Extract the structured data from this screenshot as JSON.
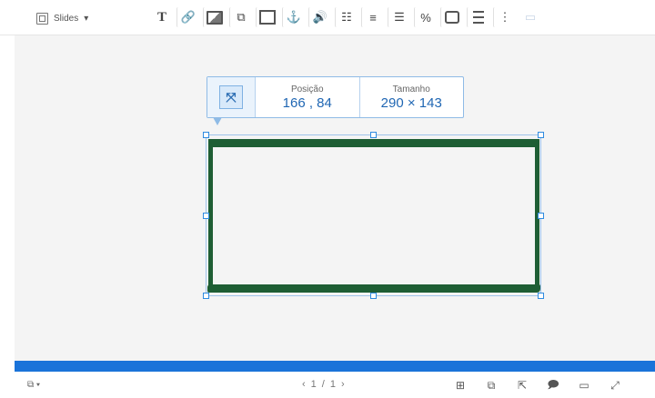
{
  "toolbar": {
    "slides_menu_label": "Slides",
    "slides_menu_caret": "▾",
    "tools": [
      {
        "name": "text-tool-icon",
        "glyph": "T"
      },
      {
        "name": "link-tool-icon",
        "glyph": "%"
      },
      {
        "name": "image-tool-icon",
        "glyph": ""
      },
      {
        "name": "shape-tool-icon",
        "glyph": "⧉"
      },
      {
        "name": "video-tool-icon",
        "glyph": ""
      },
      {
        "name": "anchor-tool-icon",
        "glyph": "⚓"
      },
      {
        "name": "audio-tool-icon",
        "glyph": "🔊"
      },
      {
        "name": "options-tool-icon",
        "glyph": "☷"
      },
      {
        "name": "numbered-list-icon",
        "glyph": "≡"
      },
      {
        "name": "bullet-list-icon",
        "glyph": "☰"
      },
      {
        "name": "percent-tool-icon",
        "glyph": "%"
      },
      {
        "name": "comment-tool-icon",
        "glyph": "🗨"
      },
      {
        "name": "align-tool-icon",
        "glyph": "≣"
      },
      {
        "name": "more-menu-icon",
        "glyph": "⋮"
      },
      {
        "name": "panel-toggle-icon",
        "glyph": "▭"
      }
    ]
  },
  "tooltip": {
    "fit_icon": "⤧",
    "position_label": "Posição",
    "position_value": "166 , 84",
    "size_label": "Tamanho",
    "size_value": "290 × 143"
  },
  "bottombar": {
    "slides_icon_caret": "▾",
    "pager": {
      "prev": "‹",
      "current": "1",
      "sep": "/",
      "total": "1",
      "next": "›"
    },
    "actions": [
      {
        "name": "add-slide-icon",
        "glyph": "⊞"
      },
      {
        "name": "duplicate-slide-icon",
        "glyph": "⧉"
      },
      {
        "name": "export-slide-icon",
        "glyph": "⇱"
      },
      {
        "name": "comment-slide-icon",
        "glyph": "🗩"
      },
      {
        "name": "notes-slide-icon",
        "glyph": "▭"
      },
      {
        "name": "fullscreen-icon",
        "glyph": "⤢"
      }
    ]
  },
  "colors": {
    "accent": "#1a73d9",
    "shape_stroke": "#1e5e34",
    "handle_border": "#2f8be0"
  }
}
